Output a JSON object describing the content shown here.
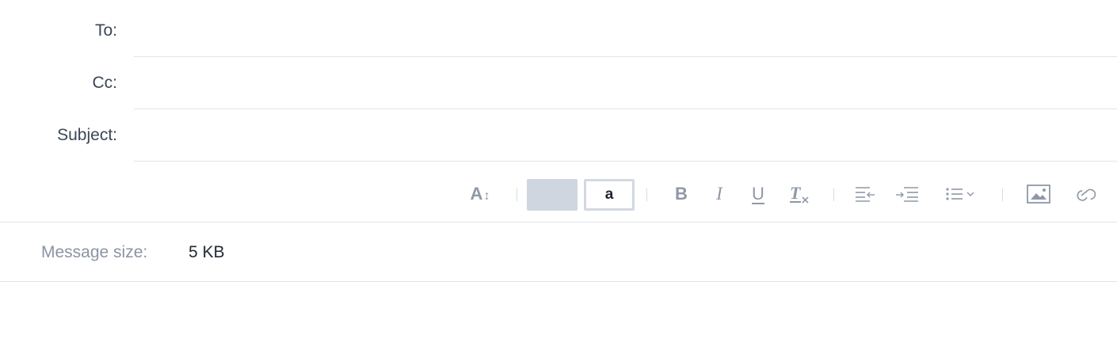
{
  "fields": {
    "to": {
      "label": "To:",
      "value": ""
    },
    "cc": {
      "label": "Cc:",
      "value": ""
    },
    "subject": {
      "label": "Subject:",
      "value": ""
    }
  },
  "toolbar": {
    "font_size": {
      "icon": "font-size-icon",
      "glyph": "A",
      "arrow": "↕"
    },
    "background_color": {
      "icon": "background-color-swatch",
      "color": "#cfd6e0"
    },
    "text_color": {
      "icon": "text-color-swatch",
      "sample": "a",
      "color": "#1e2530"
    },
    "bold": {
      "icon": "bold-icon",
      "glyph": "B"
    },
    "italic": {
      "icon": "italic-icon",
      "glyph": "I"
    },
    "underline": {
      "icon": "underline-icon",
      "glyph": "U"
    },
    "clear_formatting": {
      "icon": "clear-formatting-icon"
    },
    "outdent": {
      "icon": "outdent-icon"
    },
    "indent": {
      "icon": "indent-icon"
    },
    "list": {
      "icon": "bulleted-list-icon"
    },
    "image": {
      "icon": "insert-image-icon"
    },
    "link": {
      "icon": "insert-link-icon"
    }
  },
  "message_size": {
    "label": "Message size:",
    "value": "5 KB"
  },
  "colors": {
    "icon_gray": "#8f98a6",
    "divider": "#e1e4e8",
    "label": "#3b4656",
    "muted_label": "#8a94a2"
  }
}
